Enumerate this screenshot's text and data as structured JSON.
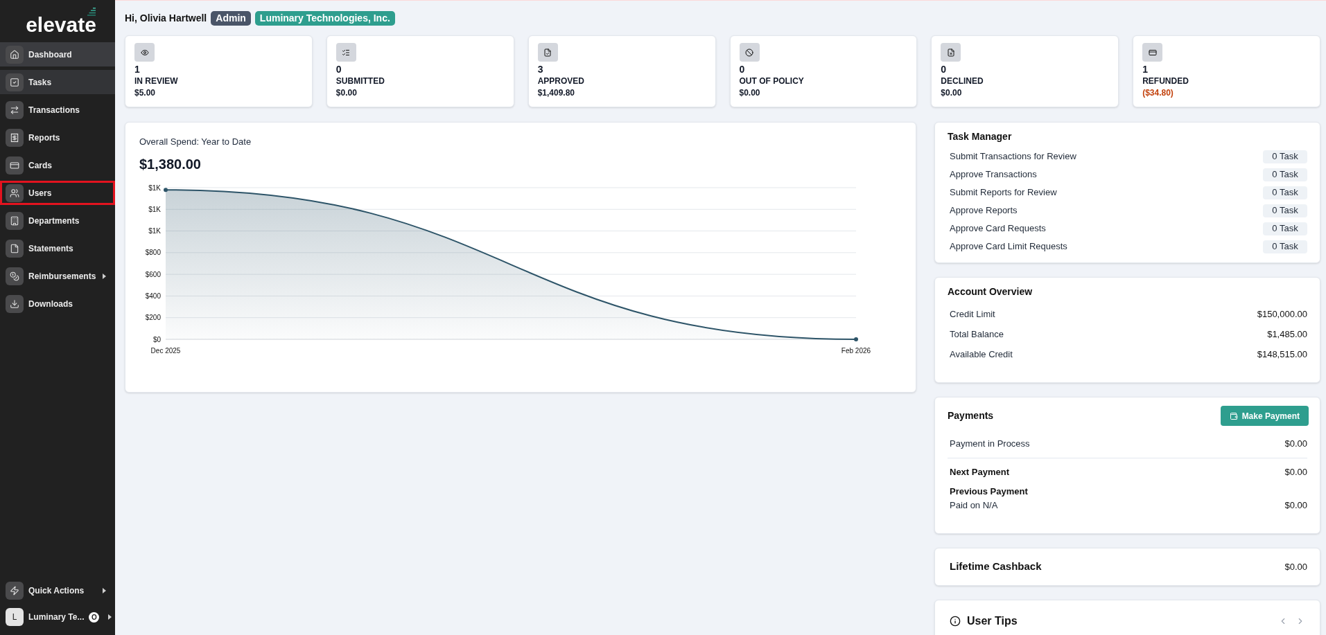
{
  "sidebar": {
    "logo": "elevate",
    "items": [
      {
        "label": "Dashboard",
        "selected": true,
        "hovered": false,
        "outlined": false,
        "has_submenu": false
      },
      {
        "label": "Tasks",
        "selected": false,
        "hovered": true,
        "outlined": false,
        "has_submenu": false
      },
      {
        "label": "Transactions",
        "selected": false,
        "hovered": false,
        "outlined": false,
        "has_submenu": false
      },
      {
        "label": "Reports",
        "selected": false,
        "hovered": false,
        "outlined": false,
        "has_submenu": false
      },
      {
        "label": "Cards",
        "selected": false,
        "hovered": false,
        "outlined": false,
        "has_submenu": false
      },
      {
        "label": "Users",
        "selected": false,
        "hovered": false,
        "outlined": true,
        "has_submenu": false
      },
      {
        "label": "Departments",
        "selected": false,
        "hovered": false,
        "outlined": false,
        "has_submenu": false
      },
      {
        "label": "Statements",
        "selected": false,
        "hovered": false,
        "outlined": false,
        "has_submenu": false
      },
      {
        "label": "Reimbursements",
        "selected": false,
        "hovered": false,
        "outlined": false,
        "has_submenu": true
      },
      {
        "label": "Downloads",
        "selected": false,
        "hovered": false,
        "outlined": false,
        "has_submenu": false
      }
    ],
    "footer": [
      {
        "kind": "action",
        "label": "Quick Actions",
        "has_submenu": true
      },
      {
        "kind": "account",
        "initial": "L",
        "label": "Luminary Te...",
        "badge": "O",
        "has_submenu": true
      }
    ]
  },
  "header": {
    "greeting": "Hi, Olivia Hartwell",
    "role": "Admin",
    "company": "Luminary Technologies, Inc."
  },
  "stats": [
    {
      "count": "1",
      "label": "IN REVIEW",
      "amount": "$5.00",
      "negative": false
    },
    {
      "count": "0",
      "label": "SUBMITTED",
      "amount": "$0.00",
      "negative": false
    },
    {
      "count": "3",
      "label": "APPROVED",
      "amount": "$1,409.80",
      "negative": false
    },
    {
      "count": "0",
      "label": "OUT OF POLICY",
      "amount": "$0.00",
      "negative": false
    },
    {
      "count": "0",
      "label": "DECLINED",
      "amount": "$0.00",
      "negative": false
    },
    {
      "count": "1",
      "label": "REFUNDED",
      "amount": "($34.80)",
      "negative": true
    }
  ],
  "spend_chart": {
    "title": "Overall Spend: Year to Date",
    "total": "$1,380.00",
    "chart_data": {
      "type": "area",
      "categories": [
        "Dec 2025",
        "Feb 2026"
      ],
      "values": [
        1380,
        0
      ],
      "ylim": [
        0,
        1400
      ],
      "yticks": [
        {
          "value": 0,
          "label": "$0"
        },
        {
          "value": 200,
          "label": "$200"
        },
        {
          "value": 400,
          "label": "$400"
        },
        {
          "value": 600,
          "label": "$600"
        },
        {
          "value": 800,
          "label": "$800"
        },
        {
          "value": 1000,
          "label": "$1K"
        },
        {
          "value": 1200,
          "label": "$1K"
        },
        {
          "value": 1400,
          "label": "$1K"
        }
      ]
    }
  },
  "task_manager": {
    "title": "Task Manager",
    "tasks": [
      {
        "label": "Submit Transactions for Review",
        "count": "0 Task"
      },
      {
        "label": "Approve Transactions",
        "count": "0 Task"
      },
      {
        "label": "Submit Reports for Review",
        "count": "0 Task"
      },
      {
        "label": "Approve Reports",
        "count": "0 Task"
      },
      {
        "label": "Approve Card Requests",
        "count": "0 Task"
      },
      {
        "label": "Approve Card Limit Requests",
        "count": "0 Task"
      }
    ]
  },
  "account_overview": {
    "title": "Account Overview",
    "rows": [
      {
        "label": "Credit Limit",
        "value": "$150,000.00"
      },
      {
        "label": "Total Balance",
        "value": "$1,485.00"
      },
      {
        "label": "Available Credit",
        "value": "$148,515.00"
      }
    ]
  },
  "payments": {
    "title": "Payments",
    "button": "Make Payment",
    "rows": [
      {
        "kind": "plain",
        "label": "Payment in Process",
        "value": "$0.00"
      },
      {
        "kind": "bold",
        "label": "Next Payment",
        "value": "$0.00"
      },
      {
        "kind": "stacked",
        "label": "Previous Payment",
        "sublabel": "Paid on N/A",
        "value": "$0.00"
      }
    ]
  },
  "cashback": {
    "label": "Lifetime Cashback",
    "value": "$0.00"
  },
  "user_tips": {
    "title": "User Tips"
  }
}
